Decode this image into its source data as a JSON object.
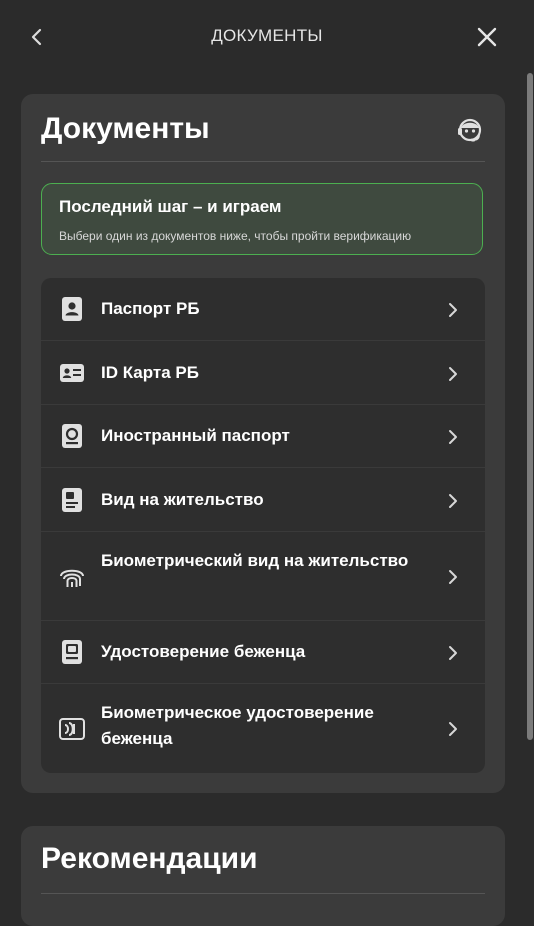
{
  "header": {
    "title": "ДОКУМЕНТЫ",
    "back_icon": "chevron-left-icon",
    "close_icon": "close-icon"
  },
  "documents_card": {
    "title": "Документы",
    "support_icon": "support-agent-icon",
    "promo": {
      "title": "Последний шаг – и играем",
      "subtitle": "Выбери один из документов ниже, чтобы пройти верификацию",
      "accent_color": "#4caf50"
    },
    "items": [
      {
        "label": "Паспорт РБ",
        "icon": "passport-icon"
      },
      {
        "label": "ID Карта РБ",
        "icon": "id-card-icon"
      },
      {
        "label": "Иностранный паспорт",
        "icon": "foreign-passport-icon"
      },
      {
        "label": "Вид на жительство",
        "icon": "residence-permit-icon"
      },
      {
        "label": "Биометрический вид на жительство",
        "icon": "biometric-residence-permit-icon"
      },
      {
        "label": "Удостоверение беженца",
        "icon": "refugee-certificate-icon"
      },
      {
        "label": "Биометрическое удостоверение беженца",
        "icon": "biometric-refugee-certificate-icon"
      }
    ]
  },
  "recommendations_card": {
    "title": "Рекомендации"
  },
  "colors": {
    "background": "#2b2b2b",
    "card": "#3b3b3b",
    "list": "#2e2e2e"
  }
}
